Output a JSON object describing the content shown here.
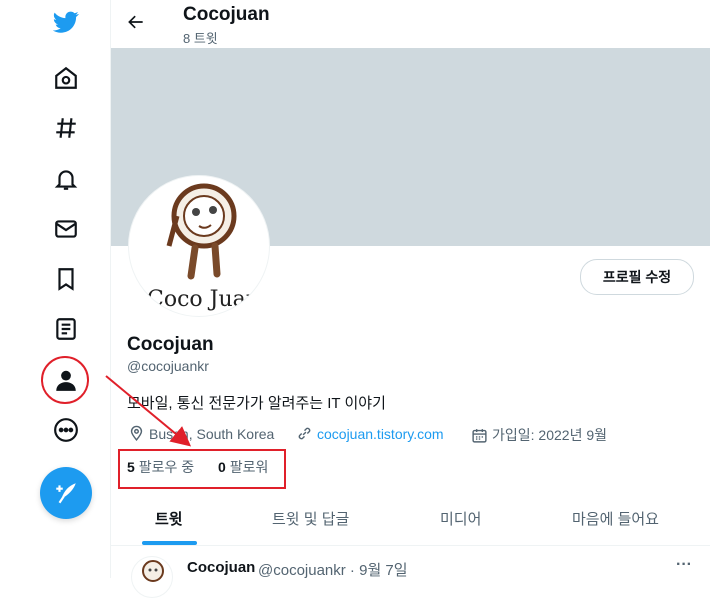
{
  "header": {
    "title": "Cocojuan",
    "tweet_count": "8 트윗"
  },
  "profile": {
    "name": "Cocojuan",
    "handle": "@cocojuankr",
    "bio": "모바일, 통신 전문가가 알려주는 IT 이야기",
    "location": "Busan, South Korea",
    "website": "cocojuan.tistory.com",
    "joined": "가입일: 2022년 9월",
    "edit_button": "프로필 수정",
    "following_count": "5",
    "following_label": "팔로우 중",
    "followers_count": "0",
    "followers_label": "팔로워",
    "avatar_text": "Coco Juan"
  },
  "tabs": [
    {
      "label": "트윗",
      "active": true
    },
    {
      "label": "트윗 및 답글",
      "active": false
    },
    {
      "label": "미디어",
      "active": false
    },
    {
      "label": "마음에 들어요",
      "active": false
    }
  ],
  "tweet": {
    "name": "Cocojuan",
    "meta": "@cocojuankr · 9월 7일",
    "more": "···"
  },
  "nav": [
    "twitter-logo",
    "home-icon",
    "explore-icon",
    "notifications-icon",
    "messages-icon",
    "bookmarks-icon",
    "lists-icon",
    "profile-icon",
    "more-icon",
    "compose-icon"
  ],
  "colors": {
    "accent": "#1d9bf0",
    "highlight": "#e0202a",
    "banner": "#cfd9de"
  }
}
